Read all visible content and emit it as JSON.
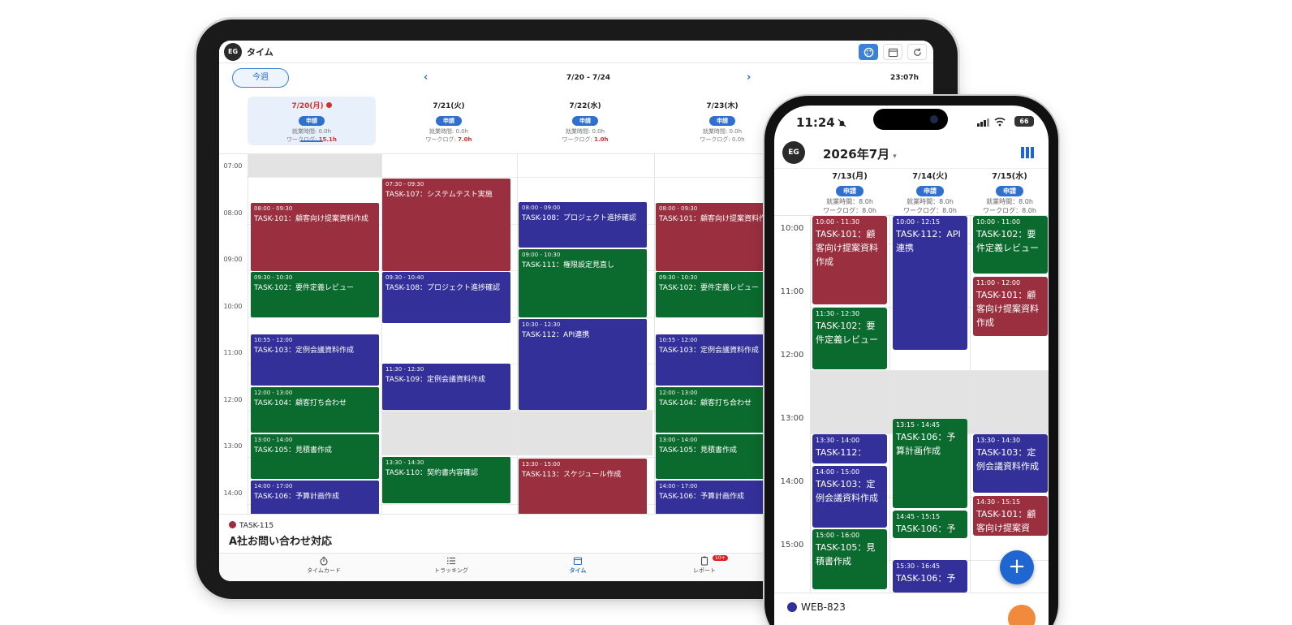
{
  "tablet": {
    "avatar": "EG",
    "title": "タイム",
    "week_button": "今週",
    "prev_icon": "chevron-left-icon",
    "next_icon": "chevron-right-icon",
    "date_range": "7/20 - 7/24",
    "total": "23:07h",
    "days": [
      {
        "label": "7/20(月)",
        "badge": "申請",
        "work": "就業時間: 0.0h",
        "worklog_label": "ワークログ: ",
        "worklog": "15.1h"
      },
      {
        "label": "7/21(火)",
        "badge": "申請",
        "work": "就業時間: 0.0h",
        "worklog_label": "ワークログ: ",
        "worklog": "7.0h"
      },
      {
        "label": "7/22(水)",
        "badge": "申請",
        "work": "就業時間: 0.0h",
        "worklog_label": "ワークログ: ",
        "worklog": "1.0h"
      },
      {
        "label": "7/23(木)",
        "badge": "申請",
        "work": "就業時間: 0.0h",
        "worklog_label": "ワークログ: ",
        "worklog": "0.0h"
      }
    ],
    "hours": [
      "07:00",
      "08:00",
      "09:00",
      "10:00",
      "11:00",
      "12:00",
      "13:00",
      "14:00"
    ],
    "events": [
      {
        "time": "08:00 - 09:30",
        "title": "TASK-101：顧客向け提案資料作成",
        "color": "#9a2f3f"
      },
      {
        "time": "09:30 - 10:30",
        "title": "TASK-102：要件定義レビュー",
        "color": "#0b6b2e"
      },
      {
        "time": "10:55 - 12:00",
        "title": "TASK-103：定例会議資料作成",
        "color": "#33309a"
      },
      {
        "time": "12:00 - 13:00",
        "title": "TASK-104：顧客打ち合わせ",
        "color": "#0b6b2e"
      },
      {
        "time": "13:00 - 14:00",
        "title": "TASK-105：見積書作成",
        "color": "#0b6b2e"
      },
      {
        "time": "14:00 - 17:00",
        "title": "TASK-106：予算計画作成",
        "color": "#33309a"
      },
      {
        "time": "07:30 - 09:30",
        "title": "TASK-107：システムテスト実施",
        "color": "#9a2f3f"
      },
      {
        "time": "09:30 - 10:40",
        "title": "TASK-108：プロジェクト進捗確認",
        "color": "#33309a"
      },
      {
        "time": "11:30 - 12:30",
        "title": "TASK-109：定例会議資料作成",
        "color": "#33309a"
      },
      {
        "time": "13:30 - 14:30",
        "title": "TASK-110：契約書内容確認",
        "color": "#0b6b2e"
      },
      {
        "time": "08:00 - 09:00",
        "title": "TASK-108：プロジェクト進捗確認",
        "color": "#33309a"
      },
      {
        "time": "09:00 - 10:30",
        "title": "TASK-111：権限設定見直し",
        "color": "#0b6b2e"
      },
      {
        "time": "10:30 - 12:30",
        "title": "TASK-112：API連携",
        "color": "#33309a"
      },
      {
        "time": "13:30 - 15:00",
        "title": "TASK-113：スケジュール作成",
        "color": "#9a2f3f"
      },
      {
        "time": "08:00 - 09:30",
        "title": "TASK-101：顧客向け提案資料作成",
        "color": "#9a2f3f"
      },
      {
        "time": "09:30 - 10:30",
        "title": "TASK-102：要件定義レビュー",
        "color": "#0b6b2e"
      },
      {
        "time": "10:55 - 12:00",
        "title": "TASK-103：定例会議資料作成",
        "color": "#33309a"
      },
      {
        "time": "12:00 - 13:00",
        "title": "TASK-104：顧客打ち合わせ",
        "color": "#0b6b2e"
      },
      {
        "time": "13:00 - 14:00",
        "title": "TASK-105：見積書作成",
        "color": "#0b6b2e"
      },
      {
        "time": "14:00 - 17:00",
        "title": "TASK-106：予算計画作成",
        "color": "#33309a"
      }
    ],
    "bottom": {
      "task_id": "TASK-115",
      "task_name": "A社お問い合わせ対応"
    },
    "tabs": [
      {
        "label": "タイムカード",
        "icon": "stopwatch-icon"
      },
      {
        "label": "トラッキング",
        "icon": "list-icon"
      },
      {
        "label": "タイム",
        "icon": "calendar-icon"
      },
      {
        "label": "レポート",
        "icon": "clipboard-icon",
        "badge": "10+"
      }
    ]
  },
  "phone": {
    "clock": "11:24",
    "battery": "66",
    "avatar": "EG",
    "month": "2026年7月",
    "month_caret": "▾",
    "days": [
      {
        "label": "7/13(月)",
        "badge": "申請",
        "work": "就業時間：8.0h",
        "worklog": "ワークログ：8.0h"
      },
      {
        "label": "7/14(火)",
        "badge": "申請",
        "work": "就業時間：8.0h",
        "worklog": "ワークログ：8.0h"
      },
      {
        "label": "7/15(水)",
        "badge": "申請",
        "work": "就業時間：8.0h",
        "worklog": "ワークログ：8.0h"
      }
    ],
    "hours": [
      "10:00",
      "11:00",
      "12:00",
      "13:00",
      "14:00",
      "15:00"
    ],
    "events": [
      {
        "time": "10:00 - 11:30",
        "title": "TASK-101：顧客向け提案資料作成",
        "color": "#9a2f3f"
      },
      {
        "time": "11:30 - 12:30",
        "title": "TASK-102：要件定義レビュー",
        "color": "#0b6b2e"
      },
      {
        "time": "13:30 - 14:00",
        "title": "TASK-112：",
        "color": "#33309a"
      },
      {
        "time": "14:00 - 15:00",
        "title": "TASK-103：定例会議資料作成",
        "color": "#33309a"
      },
      {
        "time": "15:00 - 16:00",
        "title": "TASK-105：見積書作成",
        "color": "#0b6b2e"
      },
      {
        "time": "10:00 - 12:15",
        "title": "TASK-112：API連携",
        "color": "#33309a"
      },
      {
        "time": "13:15 - 14:45",
        "title": "TASK-106：予算計画作成",
        "color": "#0b6b2e"
      },
      {
        "time": "14:45 - 15:15",
        "title": "TASK-106：予",
        "color": "#0b6b2e"
      },
      {
        "time": "15:30 - 16:45",
        "title": "TASK-106：予",
        "color": "#33309a"
      },
      {
        "time": "10:00 - 11:00",
        "title": "TASK-102：要件定義レビュー",
        "color": "#0b6b2e"
      },
      {
        "time": "11:00 - 12:00",
        "title": "TASK-101：顧客向け提案資料作成",
        "color": "#9a2f3f"
      },
      {
        "time": "13:30 - 14:30",
        "title": "TASK-103：定例会議資料作成",
        "color": "#33309a"
      },
      {
        "time": "14:30 - 15:15",
        "title": "TASK-101：顧客向け提案資",
        "color": "#9a2f3f"
      }
    ],
    "fab": "+",
    "bottom_task": "WEB-823"
  }
}
